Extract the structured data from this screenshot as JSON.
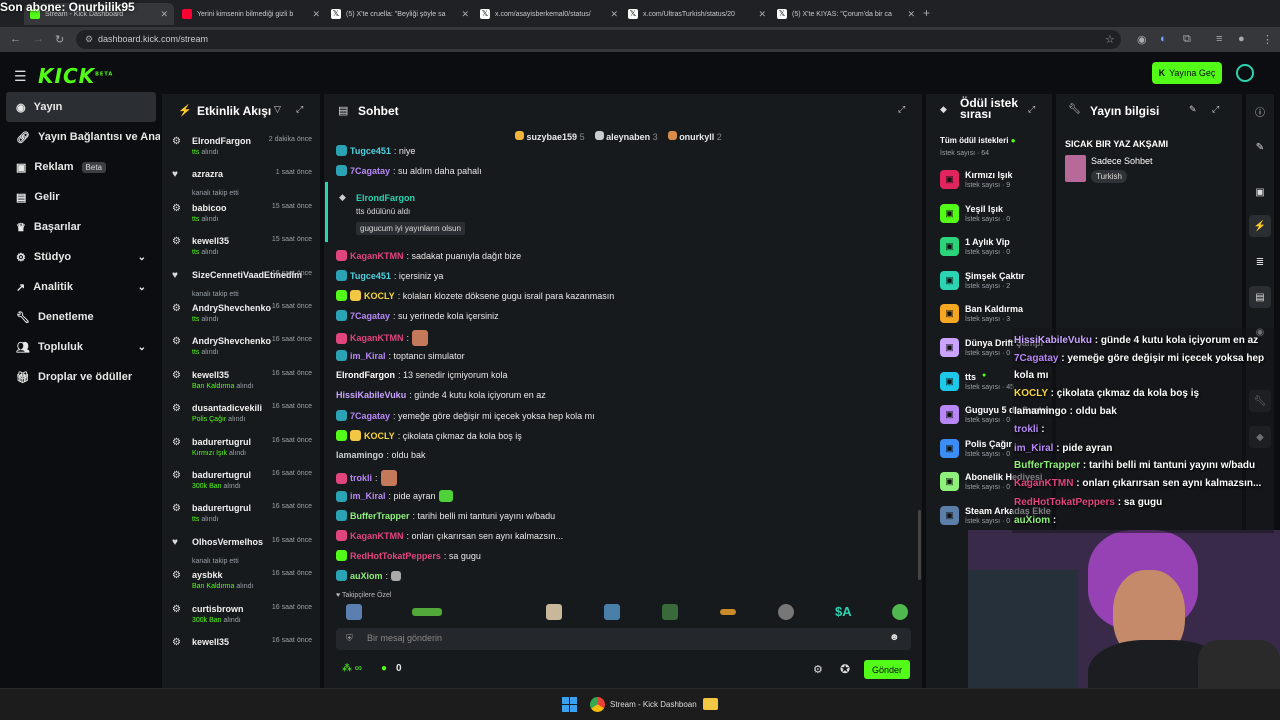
{
  "overlay_title": "Son abone: Onurbilik95",
  "browser": {
    "tabs": [
      {
        "title": "Stream - Kick Dashboard"
      },
      {
        "title": "Yerini kimsenin bilmediği gizli b"
      },
      {
        "title": "(5) X'te cruella: \"Beyliği şöyle sa"
      },
      {
        "title": "x.com/asayisberkemal0/status/"
      },
      {
        "title": "x.com/UltrasTurkish/status/20"
      },
      {
        "title": "(5) X'te KIYAS: \"Çorum'da bir ca"
      }
    ],
    "url": "dashboard.kick.com/stream"
  },
  "header": {
    "logo": "KICK",
    "logo_sup": "BETA",
    "go_live": "Yayına Geç"
  },
  "nav": {
    "items": [
      {
        "label": "Yayın"
      },
      {
        "label": "Yayın Bağlantısı ve Anahtar"
      },
      {
        "label": "Reklam"
      },
      {
        "label": "Gelir"
      },
      {
        "label": "Başarılar"
      },
      {
        "label": "Stüdyo"
      },
      {
        "label": "Analitik"
      },
      {
        "label": "Denetleme"
      },
      {
        "label": "Topluluk"
      },
      {
        "label": "Droplar ve ödüller"
      }
    ],
    "beta_badge": "Beta"
  },
  "activity": {
    "title": "Etkinlik Akışı",
    "items": [
      {
        "name": "ElrondFargon",
        "time": "2 dakika önce",
        "action": "",
        "green": "tts",
        "rest": " alındı"
      },
      {
        "name": "azrazra",
        "time": "1 saat önce",
        "action": "kanalı takip etti",
        "green": "",
        "rest": ""
      },
      {
        "name": "babicoo",
        "time": "15 saat önce",
        "action": "",
        "green": "tts",
        "rest": " alındı"
      },
      {
        "name": "kewell35",
        "time": "15 saat önce",
        "action": "",
        "green": "tts",
        "rest": " alındı"
      },
      {
        "name": "SizeCennetiVaadEtmedim",
        "time": "16 saat önce",
        "action": "kanalı takip etti",
        "green": "",
        "rest": ""
      },
      {
        "name": "AndryShevchenko",
        "time": "16 saat önce",
        "action": "",
        "green": "tts",
        "rest": " alındı"
      },
      {
        "name": "AndryShevchenko",
        "time": "16 saat önce",
        "action": "",
        "green": "tts",
        "rest": " alındı"
      },
      {
        "name": "kewell35",
        "time": "16 saat önce",
        "action": "",
        "green": "Ban Kaldırma",
        "rest": " alındı"
      },
      {
        "name": "dusantadicvekili",
        "time": "16 saat önce",
        "action": "",
        "green": "Polis Çağır",
        "rest": " alındı"
      },
      {
        "name": "badurertugrul",
        "time": "16 saat önce",
        "action": "",
        "green": "Kırmızı Işık",
        "rest": " alındı"
      },
      {
        "name": "badurertugrul",
        "time": "16 saat önce",
        "action": "",
        "green": "300k Ban",
        "rest": " alındı"
      },
      {
        "name": "badurertugrul",
        "time": "16 saat önce",
        "action": "",
        "green": "tts",
        "rest": " alındı"
      },
      {
        "name": "OlhosVermelhos",
        "time": "16 saat önce",
        "action": "kanalı takip etti",
        "green": "",
        "rest": ""
      },
      {
        "name": "aysbkk",
        "time": "16 saat önce",
        "action": "",
        "green": "Ban Kaldırma",
        "rest": " alındı"
      },
      {
        "name": "curtisbrown",
        "time": "16 saat önce",
        "action": "",
        "green": "300k Ban",
        "rest": " alındı"
      },
      {
        "name": "kewell35",
        "time": "16 saat önce",
        "action": "",
        "green": "",
        "rest": ""
      }
    ]
  },
  "chat": {
    "title": "Sohbet",
    "top_gifters": [
      {
        "name": "suzybae159",
        "count": "5",
        "color": "#f2b43a"
      },
      {
        "name": "aleynaben",
        "count": "3",
        "color": "#c9ccd0"
      },
      {
        "name": "onurkyll",
        "count": "2",
        "color": "#d98c4a"
      }
    ],
    "reward_event": {
      "user": "ElrondFargon",
      "line": "tts ödülünü aldı",
      "text": "gugucum iyi yayınların olsun"
    },
    "messages": [
      {
        "user": "Tugce451",
        "text": ": niye",
        "color": "#4fd1e0",
        "badge": "#2aa3b5"
      },
      {
        "user": "7Cagatay",
        "text": ": su aldım daha pahalı",
        "color": "#b788f5",
        "badge": "#2aa3b5"
      },
      {
        "user": "KaganKTMN",
        "text": ": sadakat puanıyla dağıt bize",
        "color": "#e0457b",
        "badge": "#e0457b"
      },
      {
        "user": "Tugce451",
        "text": ": içersiniz ya",
        "color": "#4fd1e0",
        "badge": "#2aa3b5"
      },
      {
        "user": "KOCLY",
        "text": ": kolaları klozete döksene gugu israil para kazanmasın",
        "color": "#f5d63a",
        "badge": "#53fc18"
      },
      {
        "user": "7Cagatay",
        "text": ": su yerinede kola içersiniz",
        "color": "#b788f5",
        "badge": "#2aa3b5"
      },
      {
        "user": "KaganKTMN",
        "text": ":",
        "color": "#e0457b",
        "badge": "#e0457b"
      },
      {
        "user": "im_Kiral",
        "text": ": toptancı simulator",
        "color": "#b788f5",
        "badge": "#2aa3b5"
      },
      {
        "user": "ElrondFargon",
        "text": ": 13 senedir içmiyorum kola",
        "color": "#ffffff",
        "badge": ""
      },
      {
        "user": "HissiKabiIeVuku",
        "text": ": günde 4 kutu kola içiyorum en az",
        "color": "#c9a3ff",
        "badge": ""
      },
      {
        "user": "7Cagatay",
        "text": ": yemeğe göre değişir mi içecek yoksa hep kola mı",
        "color": "#b788f5",
        "badge": "#2aa3b5"
      },
      {
        "user": "KOCLY",
        "text": ": çikolata çıkmaz da kola boş iş",
        "color": "#f5d63a",
        "badge": "#53fc18"
      },
      {
        "user": "Iamamingo",
        "text": ": oldu bak",
        "color": "#c9ccd0",
        "badge": ""
      },
      {
        "user": "trokli",
        "text": ":",
        "color": "#b788f5",
        "badge": "#e0457b"
      },
      {
        "user": "im_Kiral",
        "text": ": pide ayran",
        "color": "#b788f5",
        "badge": "#2aa3b5"
      },
      {
        "user": "BufferTrapper",
        "text": ": tarihi belli mi tantuni yayını w/badu",
        "color": "#8ef07a",
        "badge": "#2aa3b5"
      },
      {
        "user": "KaganKTMN",
        "text": ": onları çıkarırsan sen aynı kalmazsın...",
        "color": "#e0457b",
        "badge": "#e0457b"
      },
      {
        "user": "RedHotTokatPeppers",
        "text": ": sa gugu",
        "color": "#e0457b",
        "badge": "#53fc18"
      },
      {
        "user": "auXiom",
        "text": ":",
        "color": "#8ef07a",
        "badge": "#2aa3b5"
      }
    ],
    "followers_only": "Takipçilere Özel",
    "input_placeholder": "Bir mesaj gönderin",
    "points": "0",
    "send": "Gönder"
  },
  "rewards": {
    "title": "Ödül istek sırası",
    "all_label": "Tüm ödül istekleri",
    "all_count": "İstek sayısı · 64",
    "items": [
      {
        "name": "Kırmızı Işık",
        "count": "İstek sayısı · 9",
        "color": "#e0245e"
      },
      {
        "name": "Yeşil Işık",
        "count": "İstek sayısı · 0",
        "color": "#53fc18"
      },
      {
        "name": "1 Aylık Vip",
        "count": "İstek sayısı · 0",
        "color": "#2bd47a"
      },
      {
        "name": "Şimşek Çaktır",
        "count": "İstek sayısı · 2",
        "color": "#2bd4b2"
      },
      {
        "name": "Ban Kaldırma",
        "count": "İstek sayısı · 3",
        "color": "#f5a623"
      },
      {
        "name": "Dünya Drift Şampi",
        "count": "İstek sayısı · 0",
        "color": "#c9a3ff"
      },
      {
        "name": "tts",
        "count": "İstek sayısı · 45",
        "color": "#1ec8e8"
      },
      {
        "name": "Guguyu 5 dk Sustur",
        "count": "İstek sayısı · 0",
        "color": "#b788f5"
      },
      {
        "name": "Polis Çağır",
        "count": "İstek sayısı · 0",
        "color": "#3a8ef5"
      },
      {
        "name": "Abonelik Hediyesi",
        "count": "İstek sayısı · 0",
        "color": "#8ef07a"
      },
      {
        "name": "Steam Arkadaş Ekle",
        "count": "İstek sayısı · 0",
        "color": "#5b7fa8"
      }
    ]
  },
  "stream_info": {
    "title": "Yayın bilgisi",
    "stream_title": "SICAK BIR YAZ AKŞAMI",
    "category": "Sadece Sohbet",
    "tag": "Turkish"
  },
  "overlay_chat": [
    {
      "user": "HissiKabiIeVuku",
      "text": " : günde 4 kutu kola içiyorum en az",
      "color": "#c9a3ff"
    },
    {
      "user": "7Cagatay",
      "text": " : yemeğe göre değişir mi içecek yoksa hep",
      "color": "#b788f5"
    },
    {
      "user": "",
      "text": "kola mı",
      "color": "#ffffff"
    },
    {
      "user": "KOCLY",
      "text": " : çikolata çıkmaz da kola boş iş",
      "color": "#f5d63a"
    },
    {
      "user": "Iamamingo",
      "text": " : oldu bak",
      "color": "#ffffff"
    },
    {
      "user": "trokli",
      "text": " :",
      "color": "#b788f5"
    },
    {
      "user": "im_Kiral",
      "text": " : pide ayran",
      "color": "#b788f5"
    },
    {
      "user": "BufferTrapper",
      "text": " : tarihi belli mi tantuni yayını w/badu",
      "color": "#8ef07a"
    },
    {
      "user": "KaganKTMN",
      "text": " : onları çıkarırsan sen aynı kalmazsın...",
      "color": "#e0457b"
    },
    {
      "user": "RedHotTokatPeppers",
      "text": " : sa gugu",
      "color": "#e0457b"
    },
    {
      "user": "auXiom",
      "text": " :",
      "color": "#8ef07a"
    }
  ],
  "taskbar": {
    "active_app": "Stream - Kick Dashboan"
  }
}
